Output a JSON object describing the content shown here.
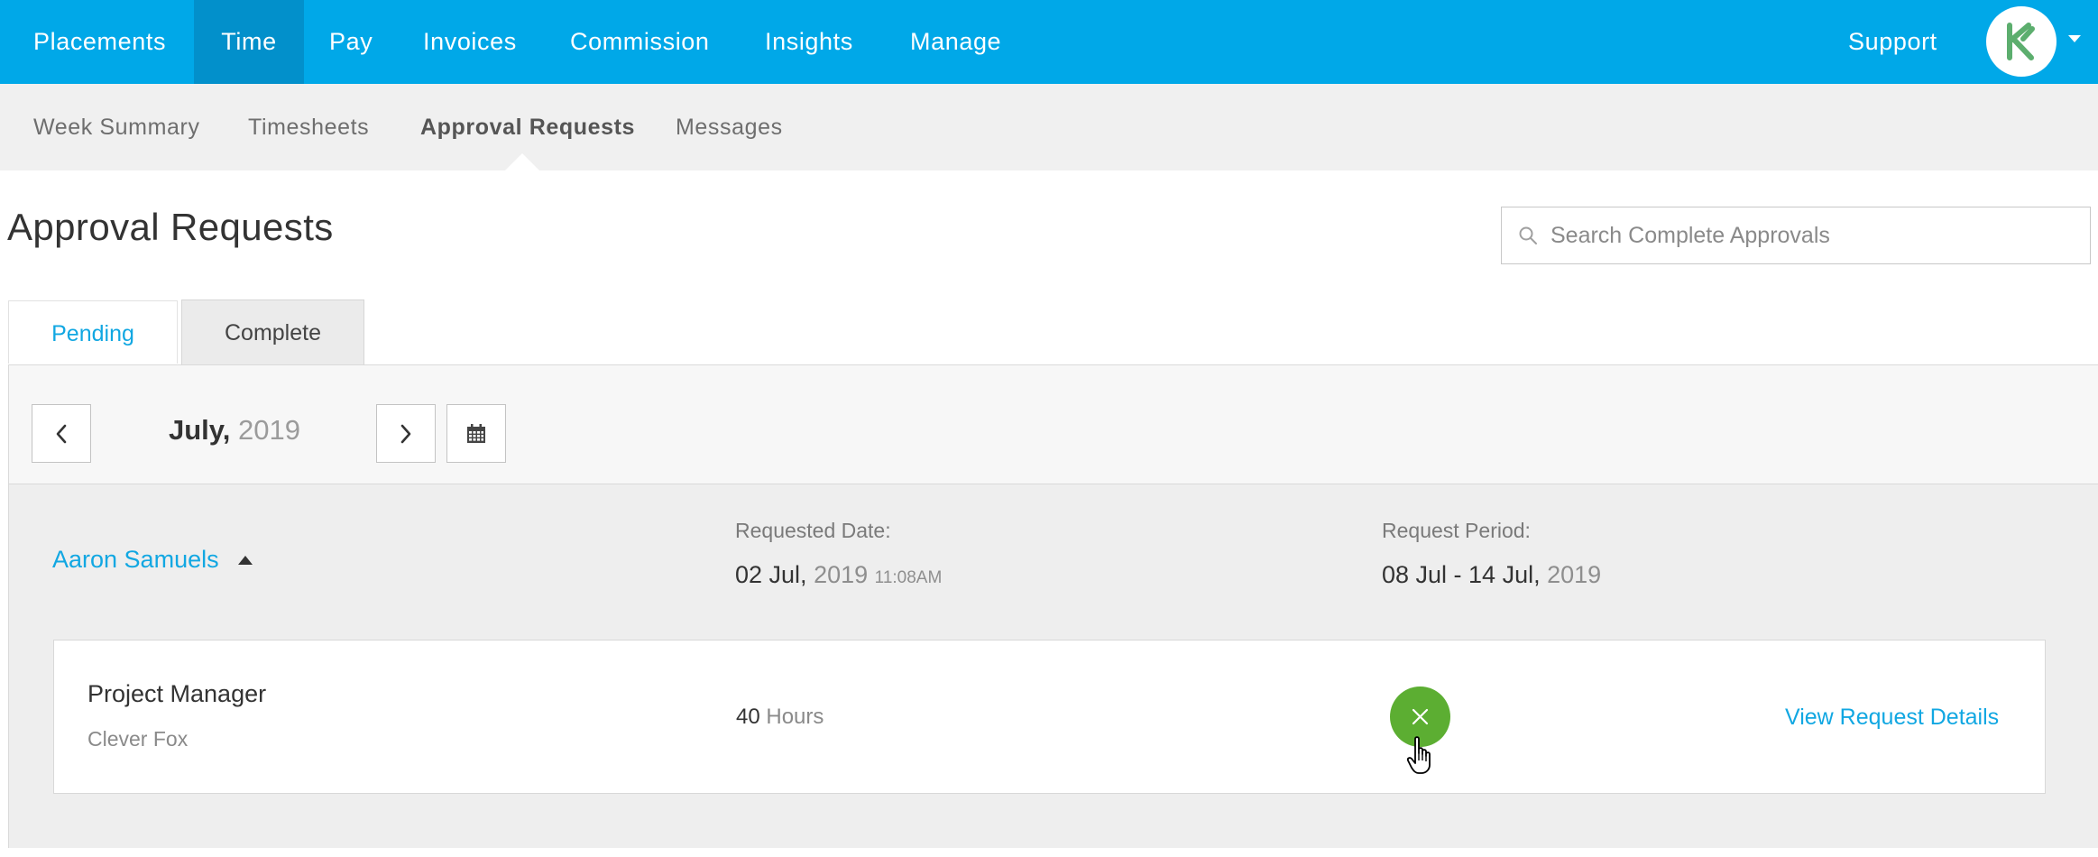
{
  "topnav": {
    "items": [
      {
        "label": "Placements",
        "active": false
      },
      {
        "label": "Time",
        "active": true
      },
      {
        "label": "Pay",
        "active": false
      },
      {
        "label": "Invoices",
        "active": false
      },
      {
        "label": "Commission",
        "active": false
      },
      {
        "label": "Insights",
        "active": false
      },
      {
        "label": "Manage",
        "active": false
      }
    ],
    "support_label": "Support",
    "avatar_icon": "brand-logo-icon",
    "menu_icon": "caret-down-icon"
  },
  "subnav": {
    "items": [
      {
        "label": "Week Summary",
        "active": false
      },
      {
        "label": "Timesheets",
        "active": false
      },
      {
        "label": "Approval Requests",
        "active": true
      },
      {
        "label": "Messages",
        "active": false
      }
    ]
  },
  "page": {
    "title": "Approval Requests",
    "search": {
      "placeholder": "Search Complete Approvals",
      "value": "",
      "icon": "search-icon"
    }
  },
  "tabs": [
    {
      "label": "Pending",
      "active": false
    },
    {
      "label": "Complete",
      "active": true
    }
  ],
  "month_nav": {
    "month": "July,",
    "year": "2019",
    "prev_icon": "chevron-left-icon",
    "next_icon": "chevron-right-icon",
    "calendar_icon": "calendar-icon"
  },
  "group": {
    "person": "Aaron Samuels",
    "expanded": true,
    "requested_date": {
      "label": "Requested Date:",
      "day_month": "02 Jul,",
      "year": "2019",
      "time": "11:08AM"
    },
    "request_period": {
      "label": "Request Period:",
      "range": "08 Jul - 14 Jul,",
      "year": "2019"
    },
    "requests": [
      {
        "job_title": "Project Manager",
        "company": "Clever Fox",
        "hours_value": "40",
        "hours_unit": "Hours",
        "status_icon": "close-icon",
        "link_label": "View Request Details"
      }
    ]
  },
  "colors": {
    "nav_bg": "#00a8e8",
    "nav_active_bg": "#0290cb",
    "link": "#11a7e2",
    "status_green": "#5cae32",
    "subnav_bg": "#f0f0f0"
  }
}
